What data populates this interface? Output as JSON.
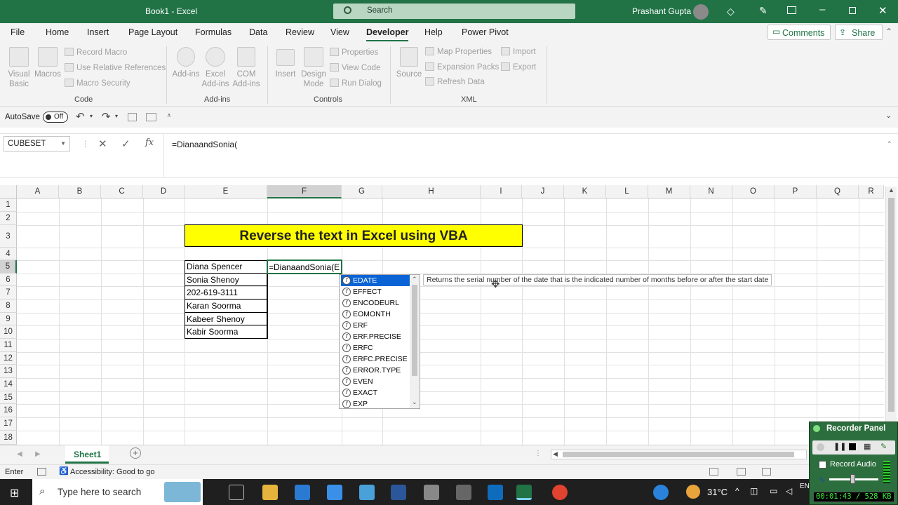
{
  "title": {
    "document": "Book1  -  Excel",
    "search_placeholder": "Search",
    "user": "Prashant Gupta"
  },
  "menu": [
    "File",
    "Home",
    "Insert",
    "Page Layout",
    "Formulas",
    "Data",
    "Review",
    "View",
    "Developer",
    "Help",
    "Power Pivot"
  ],
  "menu_right": {
    "comments": "Comments",
    "share": "Share"
  },
  "ribbon": {
    "visual_basic": "Visual Basic",
    "macros": "Macros",
    "record_macro": "Record Macro",
    "relative_refs": "Use Relative References",
    "macro_security": "Macro Security",
    "code_group": "Code",
    "addins": "Add-ins",
    "excel_addins": "Excel Add-ins",
    "com_addins": "COM Add-ins",
    "addins_group": "Add-ins",
    "insert": "Insert",
    "design_mode": "Design Mode",
    "properties": "Properties",
    "view_code": "View Code",
    "run_dialog": "Run Dialog",
    "controls_group": "Controls",
    "source": "Source",
    "map_properties": "Map Properties",
    "expansion_packs": "Expansion Packs",
    "refresh_data": "Refresh Data",
    "import": "Import",
    "export": "Export",
    "xml_group": "XML"
  },
  "qat": {
    "autosave": "AutoSave",
    "toggle": "Off"
  },
  "formula_bar": {
    "name_box": "CUBESET",
    "formula": "=DianaandSonia("
  },
  "columns": [
    "A",
    "B",
    "C",
    "D",
    "E",
    "F",
    "G",
    "H",
    "I",
    "J",
    "K",
    "L",
    "M",
    "N",
    "O",
    "P",
    "Q",
    "R"
  ],
  "rows": [
    "1",
    "2",
    "3",
    "4",
    "5",
    "6",
    "7",
    "8",
    "9",
    "10",
    "11",
    "12",
    "13",
    "14",
    "15",
    "16",
    "17",
    "18"
  ],
  "banner": "Reverse the text in Excel using VBA",
  "names": [
    "Diana Spencer",
    "Sonia Shenoy",
    "202-619-3111",
    "Karan Soorma",
    "Kabeer Shenoy",
    "Kabir Soorma"
  ],
  "active_cell": "=DianaandSonia(E",
  "autocomplete": [
    "EDATE",
    "EFFECT",
    "ENCODEURL",
    "EOMONTH",
    "ERF",
    "ERF.PRECISE",
    "ERFC",
    "ERFC.PRECISE",
    "ERROR.TYPE",
    "EVEN",
    "EXACT",
    "EXP"
  ],
  "tooltip": "Returns the serial number of the date that is the indicated number of months before or after the start date",
  "sheet_tab": "Sheet1",
  "status": {
    "mode": "Enter",
    "accessibility": "Accessibility: Good to go"
  },
  "taskbar": {
    "search": "Type here to search",
    "weather": "31°C",
    "lang": "EN"
  },
  "recorder": {
    "title": "Recorder Panel",
    "record_audio": "Record Audio",
    "timer": "00:01:43 / 528 KB"
  },
  "colors": {
    "excel_green": "#217346",
    "banner_yellow": "#ffff00",
    "selection_blue": "#0a64d6"
  }
}
